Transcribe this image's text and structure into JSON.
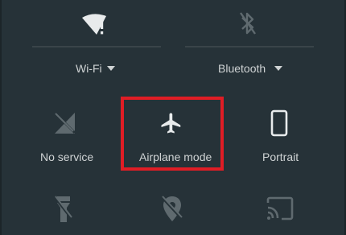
{
  "quick_settings": {
    "wifi": {
      "label": "Wi-Fi",
      "icon": "wifi-icon",
      "status_glyph": "!"
    },
    "bluetooth": {
      "label": "Bluetooth",
      "icon": "bluetooth-icon"
    },
    "no_service": {
      "label": "No service",
      "icon": "no-signal-icon"
    },
    "airplane_mode": {
      "label": "Airplane mode",
      "icon": "airplane-icon",
      "highlighted": true
    },
    "portrait": {
      "label": "Portrait",
      "icon": "phone-portrait-icon"
    },
    "flashlight": {
      "icon": "flashlight-off-icon"
    },
    "location": {
      "icon": "location-off-icon"
    },
    "cast": {
      "icon": "cast-icon"
    }
  },
  "colors": {
    "background": "#263238",
    "icon_active": "#e8ebec",
    "icon_inactive": "#5f6a6f",
    "text": "#cfd3d4",
    "highlight": "#e01d25"
  }
}
